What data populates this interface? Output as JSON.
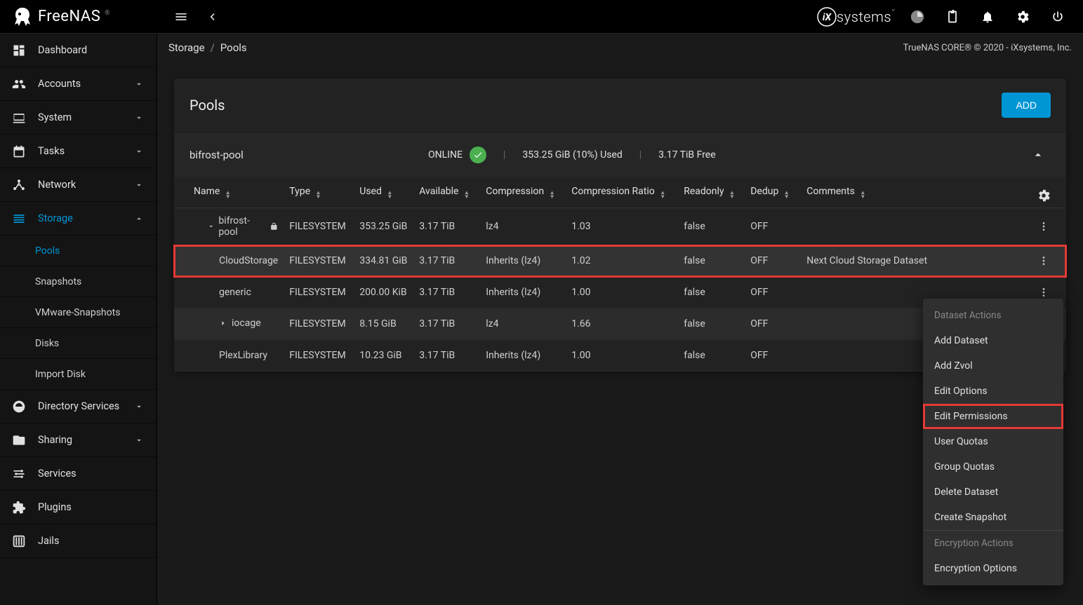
{
  "brand": "FreeNAS",
  "ix_brand": "systems",
  "topbar": {
    "copyright": "TrueNAS CORE® © 2020 - iXsystems, Inc."
  },
  "breadcrumb": {
    "root": "Storage",
    "current": "Pools"
  },
  "sidebar": {
    "items": [
      {
        "icon": "dashboard",
        "label": "Dashboard",
        "expandable": false
      },
      {
        "icon": "accounts",
        "label": "Accounts",
        "expandable": true
      },
      {
        "icon": "system",
        "label": "System",
        "expandable": true
      },
      {
        "icon": "tasks",
        "label": "Tasks",
        "expandable": true
      },
      {
        "icon": "network",
        "label": "Network",
        "expandable": true
      },
      {
        "icon": "storage",
        "label": "Storage",
        "expandable": true,
        "active": true,
        "expanded": true
      },
      {
        "icon": "directory",
        "label": "Directory Services",
        "expandable": true
      },
      {
        "icon": "sharing",
        "label": "Sharing",
        "expandable": true
      },
      {
        "icon": "services",
        "label": "Services",
        "expandable": false
      },
      {
        "icon": "plugins",
        "label": "Plugins",
        "expandable": false
      },
      {
        "icon": "jails",
        "label": "Jails",
        "expandable": false
      }
    ],
    "storage_sub": [
      {
        "label": "Pools",
        "active": true
      },
      {
        "label": "Snapshots"
      },
      {
        "label": "VMware-Snapshots"
      },
      {
        "label": "Disks"
      },
      {
        "label": "Import Disk"
      }
    ]
  },
  "page": {
    "title": "Pools",
    "add_label": "ADD"
  },
  "pool": {
    "name": "bifrost-pool",
    "status": "ONLINE",
    "used": "353.25 GiB (10%) Used",
    "free": "3.17 TiB Free"
  },
  "columns": {
    "name": "Name",
    "type": "Type",
    "used": "Used",
    "available": "Available",
    "compression": "Compression",
    "ratio": "Compression Ratio",
    "readonly": "Readonly",
    "dedup": "Dedup",
    "comments": "Comments"
  },
  "rows": [
    {
      "level": 1,
      "chev": "down",
      "name": "bifrost-pool",
      "lock": true,
      "type": "FILESYSTEM",
      "used": "353.25 GiB",
      "available": "3.17 TiB",
      "compression": "lz4",
      "ratio": "1.03",
      "readonly": "false",
      "dedup": "OFF",
      "comments": ""
    },
    {
      "level": 2,
      "name": "CloudStorage",
      "type": "FILESYSTEM",
      "used": "334.81 GiB",
      "available": "3.17 TiB",
      "compression": "Inherits (lz4)",
      "ratio": "1.02",
      "readonly": "false",
      "dedup": "OFF",
      "comments": "Next Cloud Storage Dataset",
      "highlight": true,
      "selected": true
    },
    {
      "level": 2,
      "name": "generic",
      "type": "FILESYSTEM",
      "used": "200.00 KiB",
      "available": "3.17 TiB",
      "compression": "Inherits (lz4)",
      "ratio": "1.00",
      "readonly": "false",
      "dedup": "OFF",
      "comments": ""
    },
    {
      "level": 2,
      "chev": "right",
      "name": "iocage",
      "type": "FILESYSTEM",
      "used": "8.15 GiB",
      "available": "3.17 TiB",
      "compression": "lz4",
      "ratio": "1.66",
      "readonly": "false",
      "dedup": "OFF",
      "comments": "",
      "hovered": true
    },
    {
      "level": 2,
      "name": "PlexLibrary",
      "type": "FILESYSTEM",
      "used": "10.23 GiB",
      "available": "3.17 TiB",
      "compression": "Inherits (lz4)",
      "ratio": "1.00",
      "readonly": "false",
      "dedup": "OFF",
      "comments": ""
    }
  ],
  "menu": {
    "header1": "Dataset Actions",
    "items1": [
      {
        "label": "Add Dataset"
      },
      {
        "label": "Add Zvol"
      },
      {
        "label": "Edit Options"
      },
      {
        "label": "Edit Permissions",
        "highlight": true
      },
      {
        "label": "User Quotas"
      },
      {
        "label": "Group Quotas"
      },
      {
        "label": "Delete Dataset"
      },
      {
        "label": "Create Snapshot"
      }
    ],
    "header2": "Encryption Actions",
    "items2": [
      {
        "label": "Encryption Options"
      }
    ]
  }
}
